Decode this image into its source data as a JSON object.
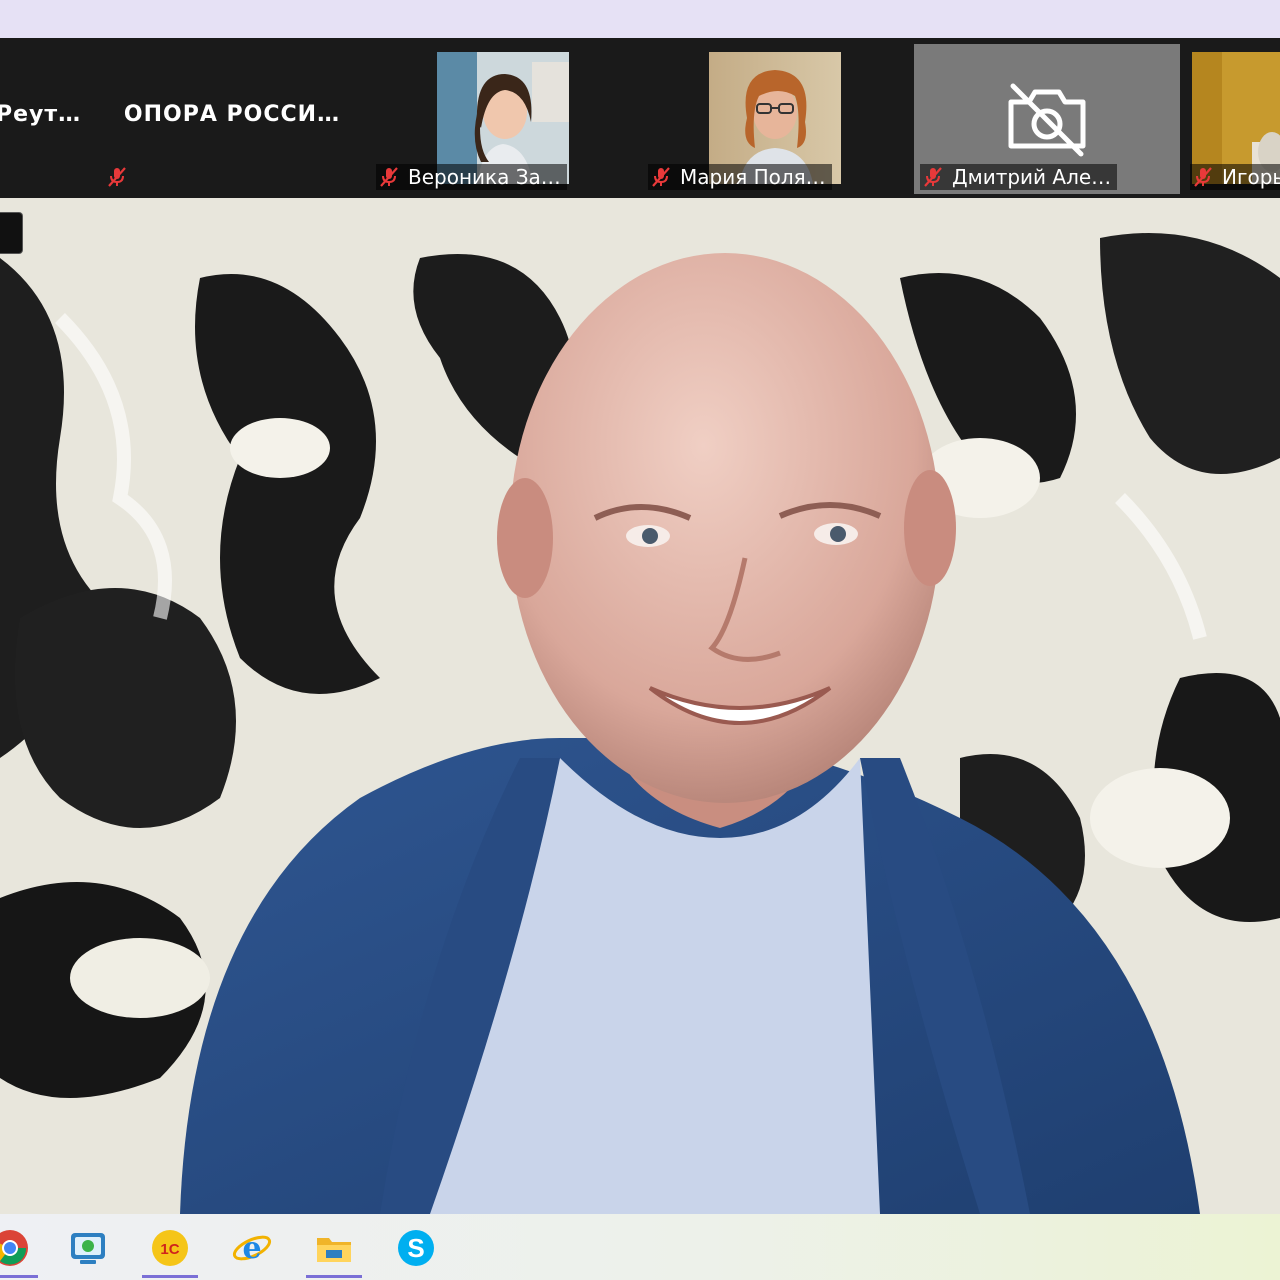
{
  "participants": [
    {
      "name": "Реут…",
      "label": "",
      "muted": false
    },
    {
      "name": "",
      "label": "ОПОРА РОССИ…",
      "muted": true
    },
    {
      "name": "Вероника За…",
      "muted": true
    },
    {
      "name": "Мария Поля…",
      "muted": true
    },
    {
      "name": "Дмитрий Але…",
      "muted": true,
      "camera_off": true
    },
    {
      "name": "Игорь",
      "muted": true
    }
  ],
  "taskbar": {
    "items": [
      {
        "icon": "chrome-icon",
        "active": true
      },
      {
        "icon": "monitor-app-icon",
        "active": false
      },
      {
        "icon": "1c-icon",
        "label": "1С",
        "active": true
      },
      {
        "icon": "internet-explorer-icon",
        "active": false
      },
      {
        "icon": "file-explorer-icon",
        "active": true
      },
      {
        "icon": "skype-icon",
        "label": "S",
        "active": false
      }
    ]
  },
  "colors": {
    "mute_red": "#e8393a",
    "taskbar_active": "#7a6fd6",
    "bar_bg": "#1a1a1a"
  }
}
